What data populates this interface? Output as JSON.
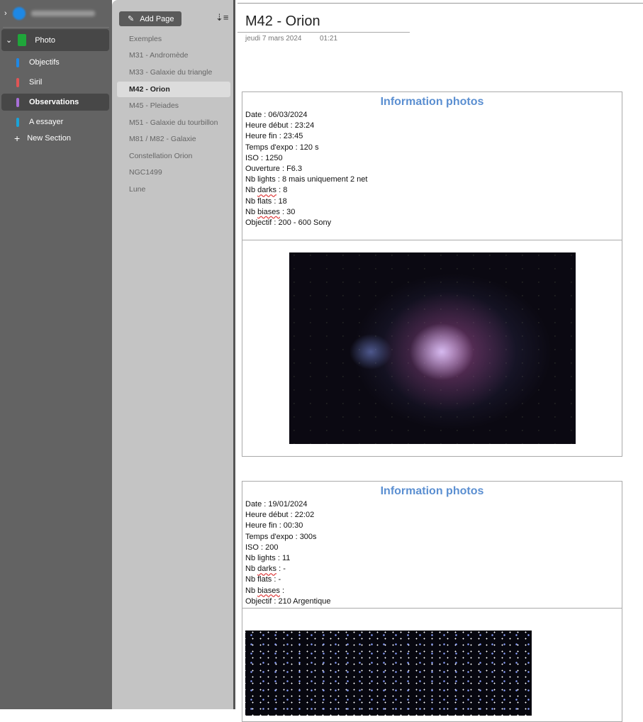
{
  "nav": {
    "notebook": "Photo",
    "sections": [
      {
        "label": "Objectifs",
        "color": "#1e88e5"
      },
      {
        "label": "Siril",
        "color": "#e05555"
      },
      {
        "label": "Observations",
        "color": "#a86fd8"
      },
      {
        "label": "A essayer",
        "color": "#1aa3d8"
      }
    ],
    "new_section": "New Section"
  },
  "pages": {
    "add_page": "Add Page",
    "items": [
      "Exemples",
      "M31 - Andromède",
      "M33 - Galaxie du triangle",
      "M42 - Orion",
      "M45 - Pleiades",
      "M51 - Galaxie du tourbillon",
      "M81 / M82 - Galaxie",
      "Constellation Orion",
      "NGC1499",
      "Lune"
    ]
  },
  "page": {
    "title": "M42 - Orion",
    "date": "jeudi 7 mars 2024",
    "time": "01:21",
    "blocks": [
      {
        "heading": "Information photos",
        "lines": [
          "Date : 06/03/2024",
          "Heure début : 23:24",
          "Heure fin : 23:45",
          "Temps d'expo : 120 s",
          "ISO : 1250",
          "Ouverture : F6.3",
          "Nb lights : 8 mais uniquement 2 net",
          "Nb darks : 8",
          "Nb flats : 18",
          "Nb biases : 30",
          "Objectif : 200 - 600 Sony"
        ]
      },
      {
        "heading": "Information photos",
        "lines": [
          "Date : 19/01/2024",
          "Heure début : 22:02",
          "Heure fin : 00:30",
          "Temps d'expo : 300s",
          "ISO : 200",
          "Nb lights : 11",
          "Nb darks : -",
          "Nb flats : -",
          "Nb biases :",
          "Objectif : 210 Argentique"
        ]
      }
    ]
  }
}
